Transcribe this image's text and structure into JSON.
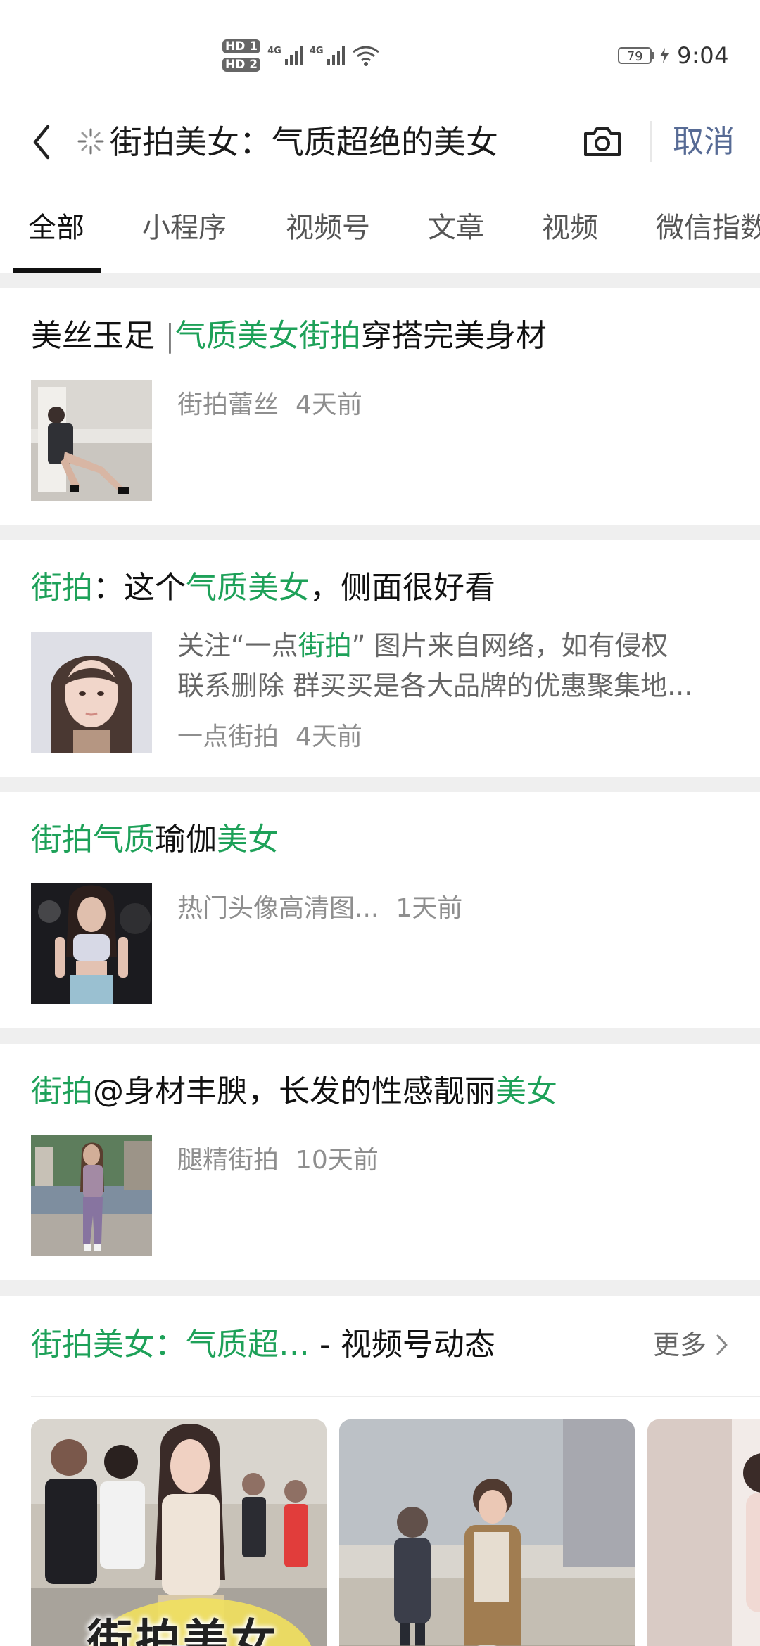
{
  "status_bar": {
    "hd_top": "HD 1",
    "hd_bottom": "HD 2",
    "network_1": "4G",
    "network_2": "4G",
    "battery": "79",
    "time": "9:04"
  },
  "header": {
    "query": "街拍美女：气质超绝的美女",
    "cancel": "取消"
  },
  "tabs": [
    {
      "label": "全部"
    },
    {
      "label": "小程序"
    },
    {
      "label": "视频号"
    },
    {
      "label": "文章"
    },
    {
      "label": "视频"
    },
    {
      "label": "微信指数"
    }
  ],
  "results": [
    {
      "title_parts": [
        "美丝玉足 ",
        "|",
        "气质美女街拍",
        "穿搭完美身材"
      ],
      "source": "街拍蕾丝",
      "time": "4天前"
    },
    {
      "title_parts": [
        "街拍",
        "：这个",
        "气质美女",
        "，侧面很好看"
      ],
      "summary_line_1_parts": [
        "关注“一点",
        "街拍",
        "” 图片来自网络，如有侵权"
      ],
      "summary_line_2": "联系删除 群买买是各大品牌的优惠聚集地...",
      "source": "一点街拍",
      "time": "4天前"
    },
    {
      "title_parts": [
        "街拍气质",
        "瑜伽",
        "美女"
      ],
      "source": "热门头像高清图...",
      "time": "1天前"
    },
    {
      "title_parts": [
        "街拍",
        "@身材丰腴，长发的性感靓丽",
        "美女"
      ],
      "source": "腿精街拍",
      "time": "10天前"
    }
  ],
  "video_section": {
    "title_highlight": "街拍美女：气质超…",
    "title_suffix": " - 视频号动态",
    "more": "更多",
    "cards": [
      {
        "overlay_text": "街拍美女"
      },
      {
        "overlay_text": ""
      },
      {
        "overlay_text": ""
      }
    ]
  },
  "colors": {
    "highlight": "#1ea159",
    "link": "#576b95",
    "background": "#efefef"
  }
}
